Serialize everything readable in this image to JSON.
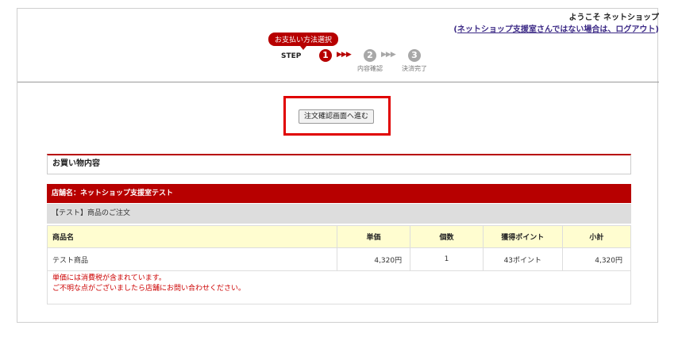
{
  "header": {
    "welcome": "ようこそ ネットショップ",
    "logout_prefix": "(",
    "logout_link": "ネットショップ支援室さんではない場合は、ログアウト",
    "logout_suffix": ")"
  },
  "steps": {
    "current_label": "お支払い方法選択",
    "step_word": "STEP",
    "items": [
      {
        "number": "1",
        "label": ""
      },
      {
        "number": "2",
        "label": "内容確認"
      },
      {
        "number": "3",
        "label": "決済完了"
      }
    ],
    "arrows": "▶▶▶"
  },
  "cta": {
    "label": "注文確認画面へ進む"
  },
  "section": {
    "title": "お買い物内容"
  },
  "shop": {
    "name": "店舗名：ネットショップ支援室テスト"
  },
  "order": {
    "title": "【テスト】商品のご注文"
  },
  "table": {
    "headers": {
      "name": "商品名",
      "price": "単価",
      "qty": "個数",
      "points": "獲得ポイント",
      "subtotal": "小計"
    },
    "rows": [
      {
        "name": "テスト商品",
        "price": "4,320円",
        "qty": "1",
        "points": "43ポイント",
        "subtotal": "4,320円"
      }
    ]
  },
  "notes": {
    "line1": "単価には消費税が含まれています。",
    "line2": "ご不明な点がございましたら店舗にお問い合わせください。"
  },
  "colors": {
    "accent": "#b70000",
    "highlight_box": "#e00000",
    "table_header_bg": "#fffdd0"
  }
}
